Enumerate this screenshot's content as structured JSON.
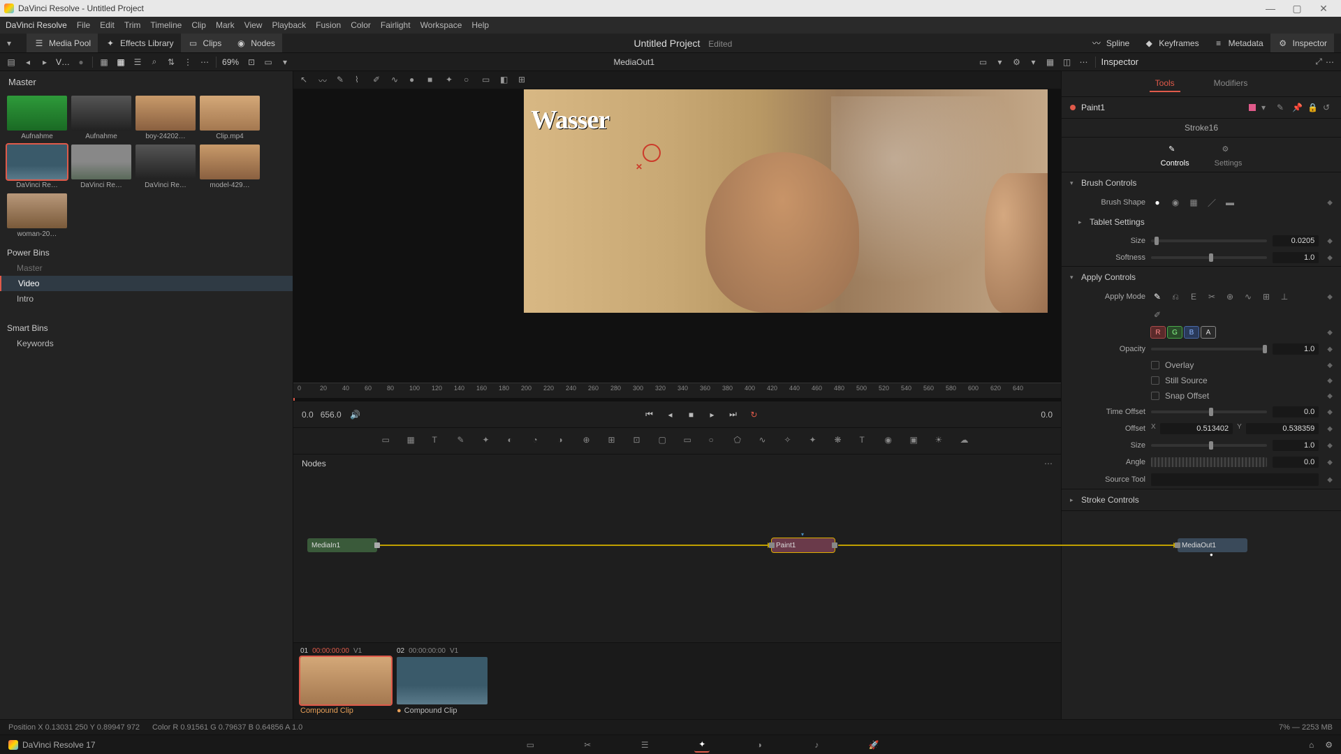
{
  "window": {
    "title": "DaVinci Resolve - Untitled Project"
  },
  "menubar": {
    "app": "DaVinci Resolve",
    "items": [
      "File",
      "Edit",
      "Trim",
      "Timeline",
      "Clip",
      "Mark",
      "View",
      "Playback",
      "Fusion",
      "Color",
      "Fairlight",
      "Workspace",
      "Help"
    ]
  },
  "toolbar1": {
    "left": [
      {
        "name": "media-pool",
        "label": "Media Pool",
        "active": true,
        "icon": "hamburger"
      },
      {
        "name": "effects-library",
        "label": "Effects Library",
        "active": false,
        "icon": "wand"
      },
      {
        "name": "clips",
        "label": "Clips",
        "active": true,
        "icon": "filmstrip"
      },
      {
        "name": "nodes",
        "label": "Nodes",
        "active": true,
        "icon": "nodes"
      }
    ],
    "project_title": "Untitled Project",
    "edited": "Edited",
    "right": [
      {
        "name": "spline",
        "label": "Spline",
        "icon": "spline"
      },
      {
        "name": "keyframes",
        "label": "Keyframes",
        "icon": "key"
      },
      {
        "name": "metadata",
        "label": "Metadata",
        "icon": "meta"
      },
      {
        "name": "inspector",
        "label": "Inspector",
        "icon": "sliders",
        "active": true
      }
    ]
  },
  "toolbar2": {
    "bin_label": "V…",
    "zoom": "69%",
    "viewer_title": "MediaOut1",
    "inspector_label": "Inspector"
  },
  "mediapool": {
    "master": "Master",
    "clips": [
      {
        "name": "Aufnahme",
        "thumb": "thumb-green"
      },
      {
        "name": "Aufnahme",
        "thumb": "thumb-bw"
      },
      {
        "name": "boy-24202…",
        "thumb": "thumb-face"
      },
      {
        "name": "Clip.mp4",
        "thumb": "thumb-couple"
      },
      {
        "name": "DaVinci Re…",
        "thumb": "thumb-lake",
        "selected": true
      },
      {
        "name": "DaVinci Re…",
        "thumb": "thumb-land"
      },
      {
        "name": "DaVinci Re…",
        "thumb": "thumb-bw"
      },
      {
        "name": "model-429…",
        "thumb": "thumb-face"
      },
      {
        "name": "woman-20…",
        "thumb": "thumb-woman"
      }
    ],
    "powerbins_label": "Power Bins",
    "powerbins": [
      {
        "label": "Master",
        "active": false,
        "dim": true
      },
      {
        "label": "Video",
        "active": true
      },
      {
        "label": "Intro",
        "active": false
      }
    ],
    "smartbins_label": "Smart Bins",
    "smartbins": [
      {
        "label": "Keywords"
      }
    ]
  },
  "viewer": {
    "ruler_ticks": [
      "0",
      "20",
      "40",
      "60",
      "80",
      "100",
      "120",
      "140",
      "160",
      "180",
      "200",
      "220",
      "240",
      "260",
      "280",
      "300",
      "320",
      "340",
      "360",
      "380",
      "400",
      "420",
      "440",
      "460",
      "480",
      "500",
      "520",
      "540",
      "560",
      "580",
      "600",
      "620",
      "640"
    ],
    "tc_start": "0.0",
    "tc_end": "656.0",
    "tc_right": "0.0"
  },
  "inspector": {
    "tabs": {
      "tools": "Tools",
      "modifiers": "Modifiers"
    },
    "node_name": "Paint1",
    "stroke": "Stroke16",
    "subtabs": {
      "controls": "Controls",
      "settings": "Settings"
    },
    "brush_controls": {
      "title": "Brush Controls",
      "shape_label": "Brush Shape",
      "tablet_label": "Tablet Settings",
      "size_label": "Size",
      "size_val": "0.0205",
      "softness_label": "Softness",
      "softness_val": "1.0"
    },
    "apply_controls": {
      "title": "Apply Controls",
      "mode_label": "Apply Mode",
      "channels": {
        "r": "R",
        "g": "G",
        "b": "B",
        "a": "A"
      },
      "opacity_label": "Opacity",
      "opacity_val": "1.0",
      "overlay_label": "Overlay",
      "still_label": "Still Source",
      "snap_label": "Snap Offset",
      "timeoffset_label": "Time Offset",
      "timeoffset_val": "0.0",
      "offset_label": "Offset",
      "offset_x": "0.513402",
      "offset_y": "0.538359",
      "x": "X",
      "y": "Y",
      "size2_label": "Size",
      "size2_val": "1.0",
      "angle_label": "Angle",
      "angle_val": "0.0",
      "sourcetool_label": "Source Tool"
    },
    "stroke_controls": {
      "title": "Stroke Controls"
    }
  },
  "nodes_panel": {
    "title": "Nodes",
    "nodes": {
      "mediain": "MediaIn1",
      "paint": "Paint1",
      "mediaout": "MediaOut1"
    }
  },
  "cliprow": {
    "clips": [
      {
        "idx": "01",
        "tc": "00:00:00:00",
        "trk": "V1",
        "label": "Compound Clip",
        "thumb": "thumb-couple",
        "active": true
      },
      {
        "idx": "02",
        "tc": "00:00:00:00",
        "trk": "V1",
        "label": "Compound Clip",
        "thumb": "thumb-lake",
        "active": false
      }
    ]
  },
  "status": {
    "position": "Position   X 0.13031   250    Y 0.89947   972",
    "color": "Color R 0.91561   G 0.79637   B 0.64856   A 1.0",
    "mem": "7% — 2253 MB"
  },
  "pagebar": {
    "app": "DaVinci Resolve 17"
  }
}
